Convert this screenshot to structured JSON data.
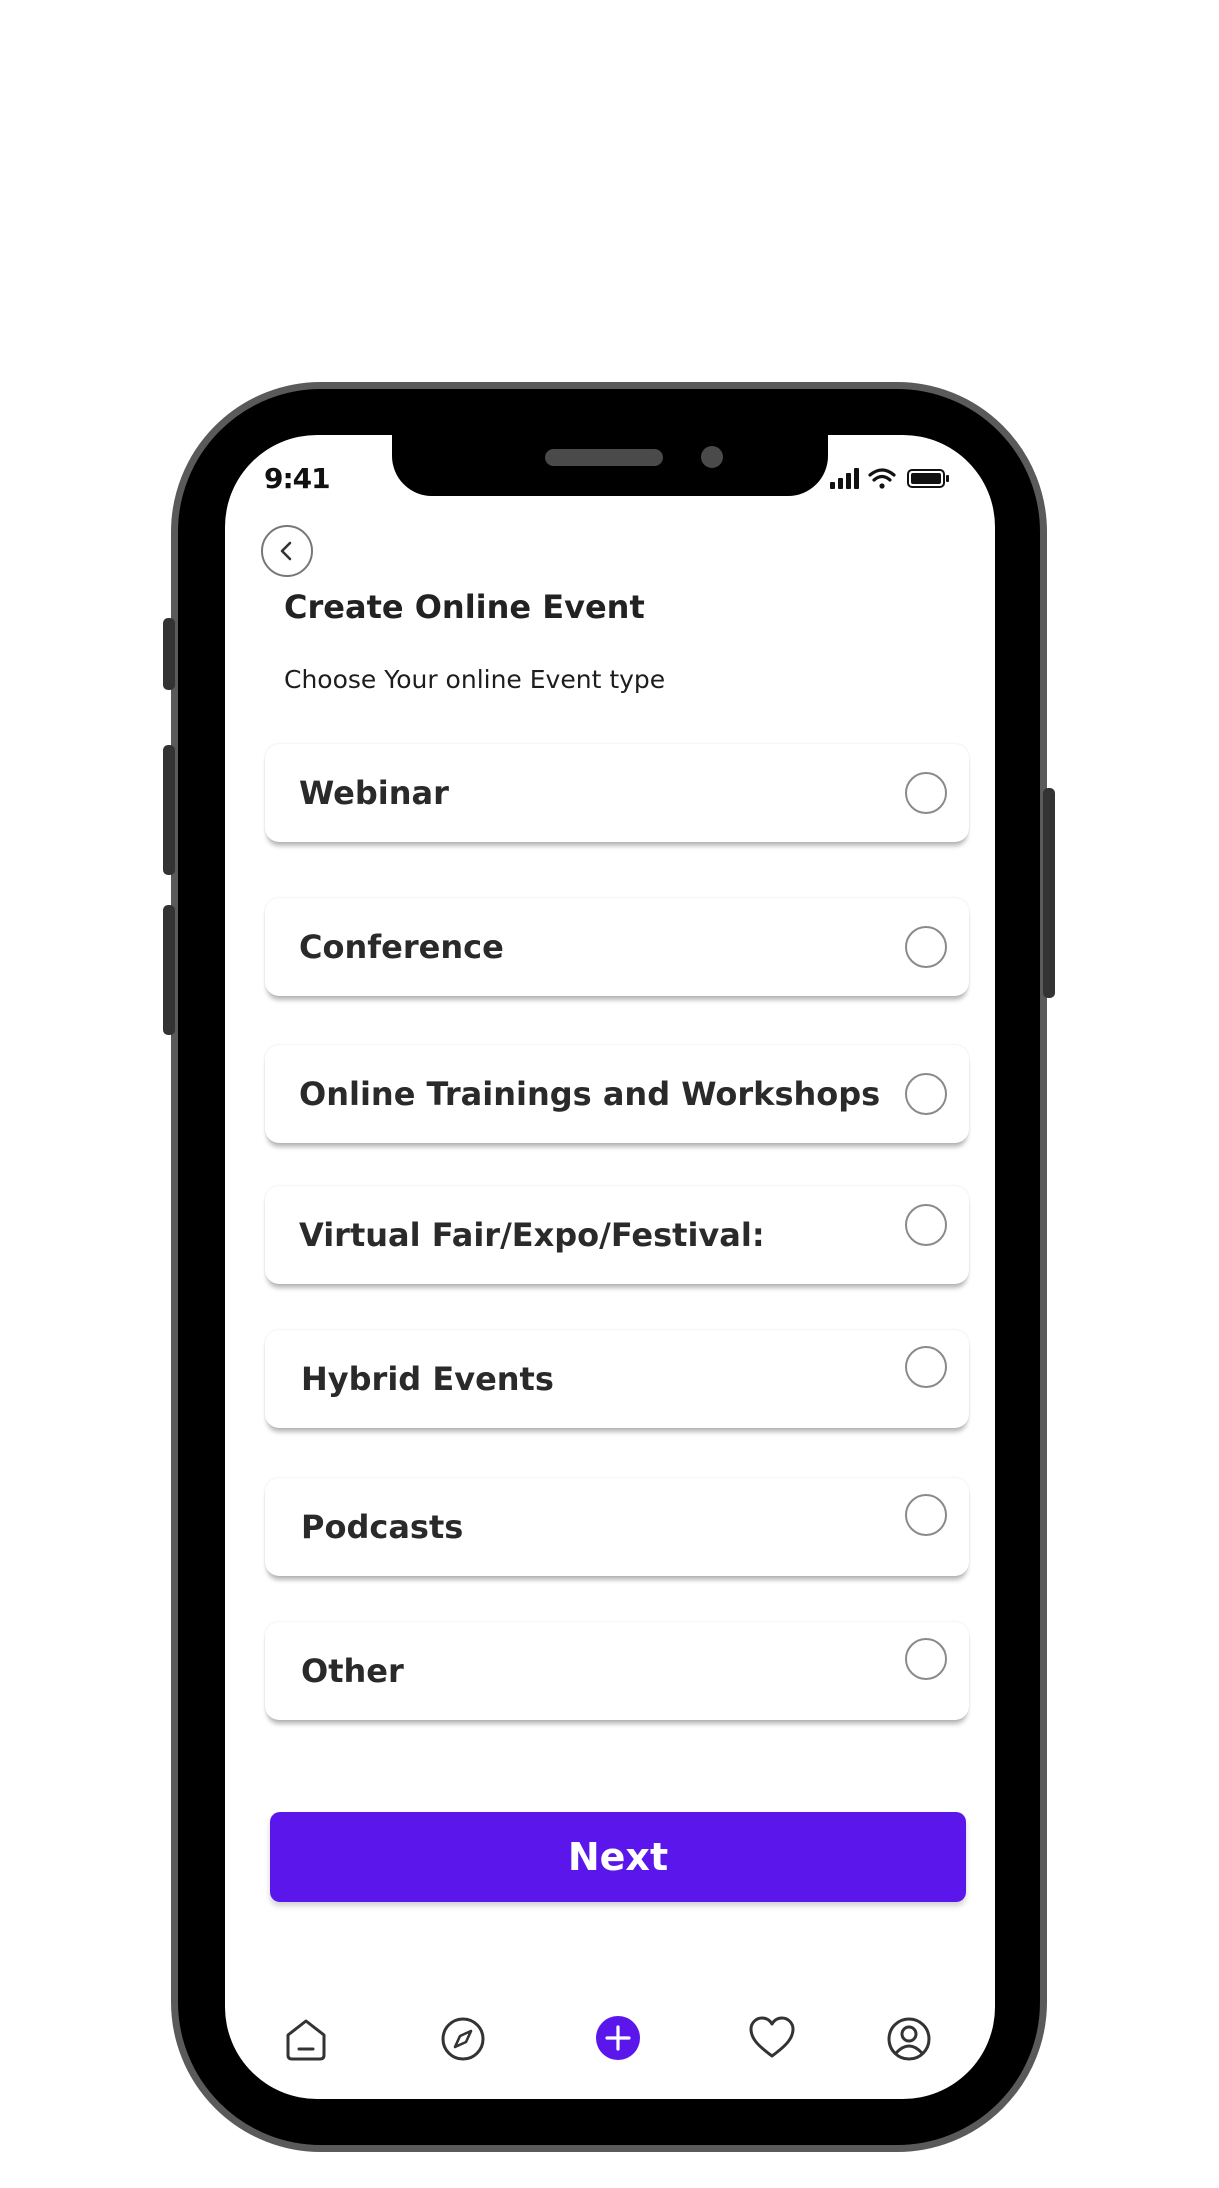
{
  "status_bar": {
    "time": "9:41"
  },
  "header": {
    "title": "Create Online Event",
    "subtitle": "Choose Your online Event type"
  },
  "options": [
    {
      "label": "Webinar",
      "selected": false
    },
    {
      "label": "Conference",
      "selected": false
    },
    {
      "label": "Online Trainings and Workshops",
      "selected": false
    },
    {
      "label": "Virtual Fair/Expo/Festival:",
      "selected": false
    },
    {
      "label": "Hybrid Events",
      "selected": false
    },
    {
      "label": "Podcasts",
      "selected": false
    },
    {
      "label": "Other",
      "selected": false
    }
  ],
  "next_button": {
    "label": "Next"
  },
  "bottom_nav": [
    {
      "icon": "home-icon"
    },
    {
      "icon": "compass-icon"
    },
    {
      "icon": "add-circle-icon"
    },
    {
      "icon": "heart-icon"
    },
    {
      "icon": "profile-icon"
    }
  ],
  "colors": {
    "accent": "#5b16ec",
    "text": "#222222",
    "frame": "#000000"
  }
}
